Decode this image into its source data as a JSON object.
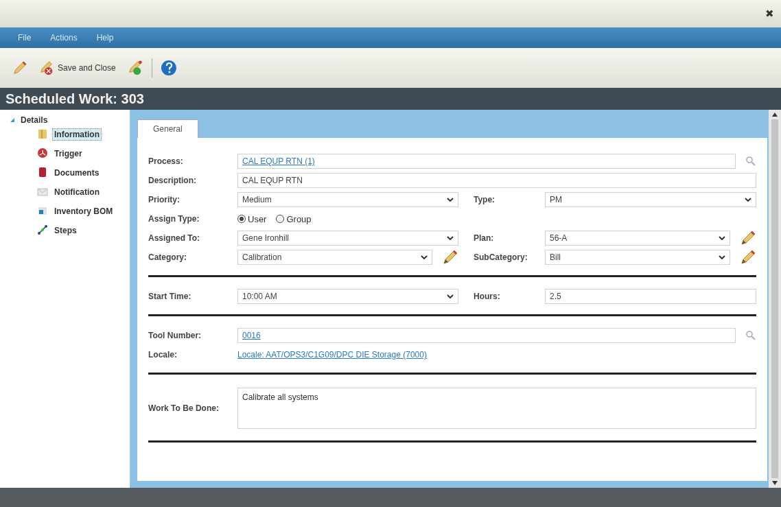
{
  "window": {
    "close": "✖"
  },
  "menu": [
    "File",
    "Actions",
    "Help"
  ],
  "toolbar": [
    {
      "kind": "edit"
    },
    {
      "kind": "save-close",
      "label": "Save and Close"
    },
    {
      "kind": "save-new"
    },
    {
      "kind": "separator"
    },
    {
      "kind": "help"
    }
  ],
  "header": "Scheduled Work: 303",
  "tree": {
    "label": "Details",
    "expanded": true,
    "children": [
      {
        "label": "Information",
        "kind": "info",
        "selected": true
      },
      {
        "label": "Trigger",
        "kind": "trigger",
        "selected": false
      },
      {
        "label": "Documents",
        "kind": "documents",
        "selected": false
      },
      {
        "label": "Notification",
        "kind": "notification",
        "selected": false
      },
      {
        "label": "Inventory BOM",
        "kind": "inventory",
        "selected": false
      },
      {
        "label": "Steps",
        "kind": "steps",
        "selected": false
      }
    ]
  },
  "tabs": [
    {
      "label": "General",
      "selected": true
    }
  ],
  "sections": [
    {
      "rows": [
        {
          "fields": [
            {
              "label": "Process:",
              "kind": "lookup",
              "value": "CAL EQUP RTN (1)"
            }
          ]
        },
        {
          "fields": [
            {
              "label": "Description:",
              "kind": "text",
              "value": "CAL EQUP RTN"
            }
          ]
        },
        {
          "fields": [
            {
              "label": "Priority:",
              "kind": "select",
              "value": "Medium",
              "pencil": false
            },
            {
              "label": "Type:",
              "kind": "select",
              "value": "PM",
              "pencil": false
            }
          ]
        },
        {
          "fields": [
            {
              "label": "Assign Type:",
              "kind": "radio",
              "options": [
                {
                  "label": "User",
                  "selected": true
                },
                {
                  "label": "Group",
                  "selected": false
                }
              ]
            }
          ]
        },
        {
          "fields": [
            {
              "label": "Assigned To:",
              "kind": "select",
              "value": "Gene Ironhill",
              "pencil": false
            },
            {
              "label": "Plan:",
              "kind": "select",
              "value": "56-A",
              "pencil": true
            }
          ]
        },
        {
          "fields": [
            {
              "label": "Category:",
              "kind": "select",
              "value": "Calibration",
              "pencil": true
            },
            {
              "label": "SubCategory:",
              "kind": "select",
              "value": "Bill",
              "pencil": true
            }
          ]
        }
      ]
    },
    {
      "rows": [
        {
          "fields": [
            {
              "label": "Start Time:",
              "kind": "select",
              "value": "10:00 AM",
              "pencil": false
            },
            {
              "label": "Hours:",
              "kind": "text",
              "value": "2.5"
            }
          ]
        }
      ]
    },
    {
      "rows": [
        {
          "fields": [
            {
              "label": "Tool Number:",
              "kind": "lookup",
              "value": "0016"
            }
          ]
        },
        {
          "fields": [
            {
              "label": "Locale:",
              "kind": "link",
              "value": "Locale: AAT/OPS3/C1G09/DPC DIE Storage (7000)"
            }
          ]
        }
      ]
    },
    {
      "rows": [
        {
          "fields": [
            {
              "label": "Work To Be Done:",
              "kind": "textarea",
              "value": "Calibrate all systems"
            }
          ]
        }
      ]
    }
  ]
}
